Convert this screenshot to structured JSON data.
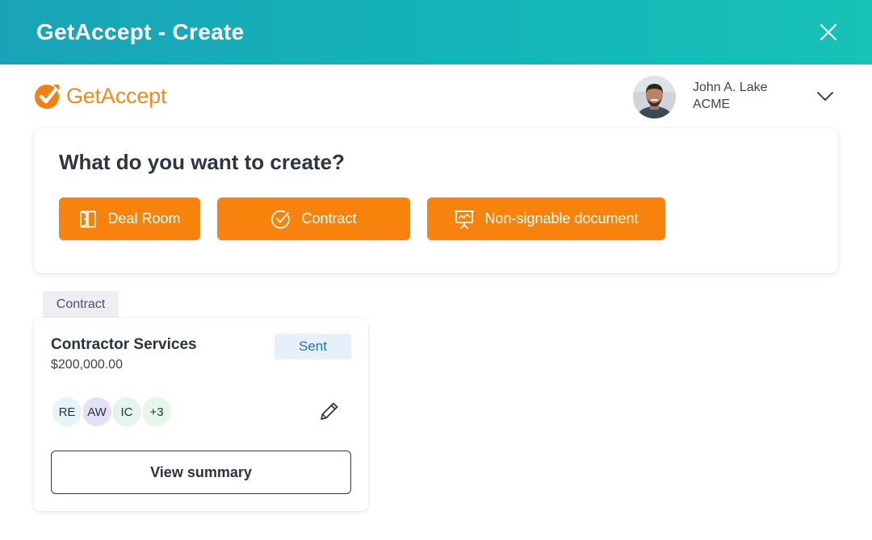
{
  "window": {
    "title": "GetAccept - Create"
  },
  "header": {
    "logo_text": "GetAccept",
    "user": {
      "name": "John A. Lake",
      "org": "ACME"
    }
  },
  "create": {
    "heading": "What do you want to create?",
    "buttons": [
      {
        "label": "Deal Room",
        "icon": "door-icon"
      },
      {
        "label": "Contract",
        "icon": "check-circle-icon"
      },
      {
        "label": "Non-signable document",
        "icon": "presentation-icon"
      }
    ]
  },
  "document": {
    "type_tag": "Contract",
    "title": "Contractor Services",
    "amount": "$200,000.00",
    "status": "Sent",
    "recipients": [
      "RE",
      "AW",
      "IC",
      "+3"
    ],
    "action_label": "View summary"
  },
  "colors": {
    "titlebar_start": "#1aa3b8",
    "titlebar_end": "#17c2b6",
    "accent_orange": "#f7830c",
    "status_blue": "#2a6fb5"
  }
}
